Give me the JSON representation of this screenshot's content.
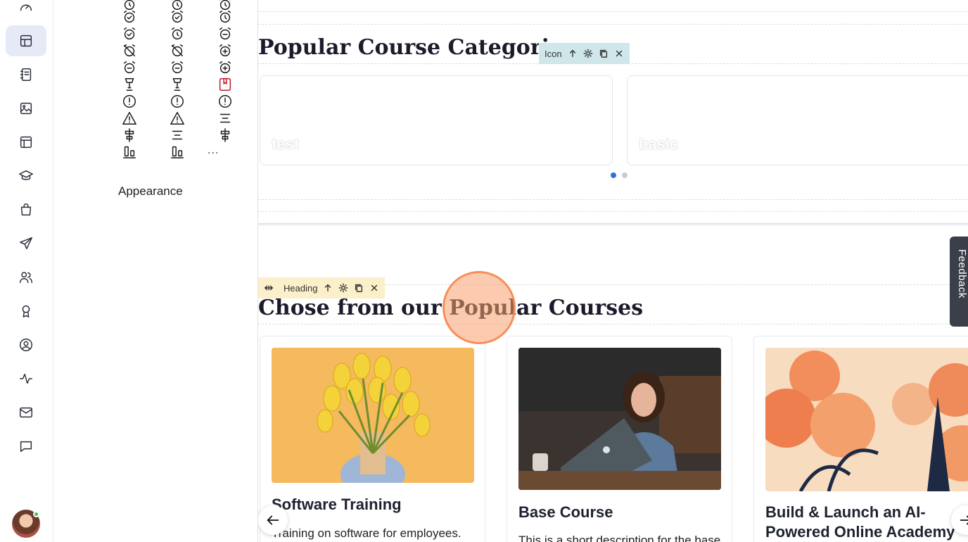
{
  "panel": {
    "appearance_label": "Appearance",
    "more_label": "..."
  },
  "canvas": {
    "categories_title": "Popular Course Categories",
    "icon_toolbar_label": "Icon",
    "categories": [
      {
        "label": "test"
      },
      {
        "label": "basic"
      }
    ],
    "heading_toolbar_label": "Heading",
    "courses_title": "Chose from our Popular Courses",
    "courses": [
      {
        "title": "Software Training",
        "description": "Training on software for employees."
      },
      {
        "title": "Base Course",
        "description": "This is a short description for the base"
      },
      {
        "title": "Build & Launch an AI-Powered Online Academy",
        "description": ""
      }
    ],
    "feedback_label": "Feedback"
  },
  "colors": {
    "active_rail_bg": "#e6eaf7",
    "icon_toolbar_bg": "#cfe6ea",
    "heading_toolbar_bg": "#fbf0c9",
    "carousel_dot_active": "#2f6fe0",
    "carousel_dot_inactive": "#c8ccd6",
    "feedback_bg": "#3a3f49",
    "cursor_highlight": "#f68c56"
  }
}
